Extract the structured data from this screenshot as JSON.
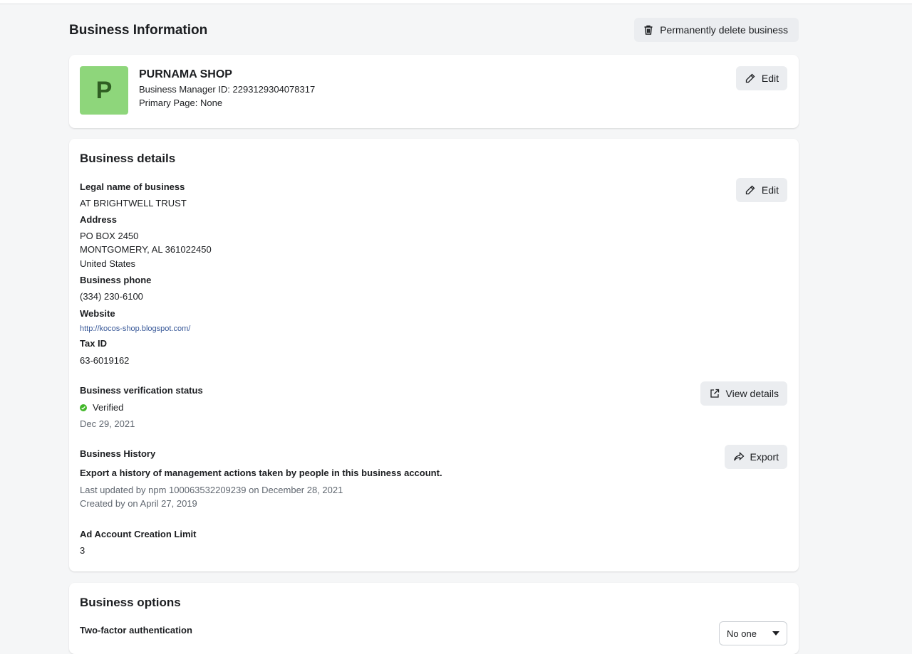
{
  "header": {
    "title": "Business Information",
    "delete_label": "Permanently delete business"
  },
  "profile": {
    "avatar_letter": "P",
    "avatar_color": "#8ed67b",
    "name": "PURNAMA SHOP",
    "manager_id": "Business Manager ID: 2293129304078317",
    "primary_page": "Primary Page: None",
    "edit_label": "Edit"
  },
  "details": {
    "title": "Business details",
    "edit_label": "Edit",
    "legal_name_label": "Legal name of business",
    "legal_name": "AT BRIGHTWELL TRUST",
    "address_label": "Address",
    "address_line1": "PO BOX 2450",
    "address_line2": "MONTGOMERY, AL 361022450",
    "address_line3": "United States",
    "phone_label": "Business phone",
    "phone": "(334) 230-6100",
    "website_label": "Website",
    "website": "http://kocos-shop.blogspot.com/",
    "tax_label": "Tax ID",
    "tax_id": "63-6019162",
    "verification_label": "Business verification status",
    "verification_status": "Verified",
    "verification_date": "Dec 29, 2021",
    "view_details_label": "View details",
    "history_label": "Business History",
    "history_desc": "Export a history of management actions taken by people in this business account.",
    "history_updated": "Last updated by npm 100063532209239 on December 28, 2021",
    "history_created": "Created by on April 27, 2019",
    "export_label": "Export",
    "ad_limit_label": "Ad Account Creation Limit",
    "ad_limit": "3",
    "verified_color": "#42b72a",
    "link_color": "#385898"
  },
  "options": {
    "title": "Business options",
    "twofa_label": "Two-factor authentication",
    "twofa_value": "No one"
  }
}
